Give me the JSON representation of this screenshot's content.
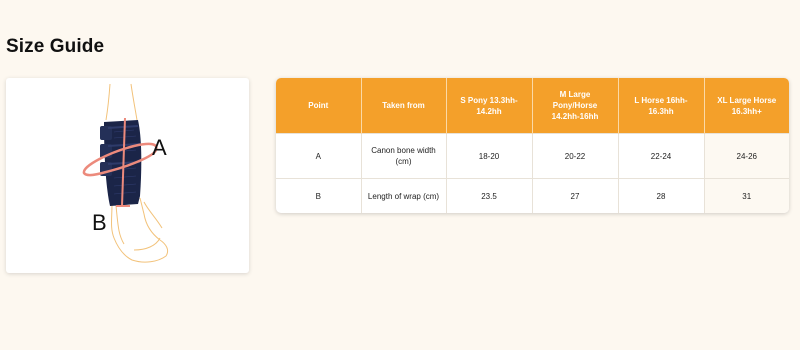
{
  "page": {
    "title": "Size Guide"
  },
  "illustration": {
    "label_a": "A",
    "label_b": "B"
  },
  "size_table": {
    "headers": [
      "Point",
      "Taken from",
      "S Pony 13.3hh-14.2hh",
      "M Large Pony/Horse 14.2hh-16hh",
      "L Horse 16hh-16.3hh",
      "XL Large Horse 16.3hh+"
    ],
    "rows": [
      [
        "A",
        "Canon bone width (cm)",
        "18-20",
        "20-22",
        "22-24",
        "24-26"
      ],
      [
        "B",
        "Length of wrap (cm)",
        "23.5",
        "27",
        "28",
        "31"
      ]
    ]
  },
  "colors": {
    "header_orange": "#f4a02a",
    "page_background": "#fdf8f0",
    "boot_navy": "#1b2548",
    "measure_pink": "#ec8a7c"
  }
}
